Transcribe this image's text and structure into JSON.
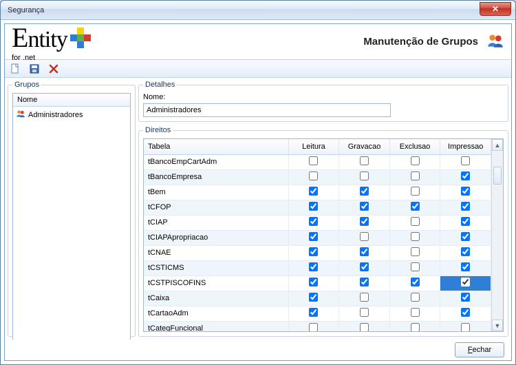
{
  "window": {
    "title": "Segurança"
  },
  "logo": {
    "text": "Entity",
    "tagline": "for .net"
  },
  "header": {
    "title": "Manutenção de Grupos"
  },
  "toolbar": {
    "new_label": "Novo",
    "save_label": "Salvar",
    "delete_label": "Excluir"
  },
  "grupos": {
    "legend": "Grupos",
    "column": "Nome",
    "items": [
      {
        "name": "Administradores",
        "selected": true
      }
    ]
  },
  "detalhes": {
    "legend": "Detalhes",
    "nome_label": "Nome:",
    "nome_value": "Administradores"
  },
  "direitos": {
    "legend": "Direitos",
    "columns": {
      "tabela": "Tabela",
      "leitura": "Leitura",
      "gravacao": "Gravacao",
      "exclusao": "Exclusao",
      "impressao": "Impressao"
    },
    "rows": [
      {
        "tabela": "tBancoEmpCartAdm",
        "leitura": false,
        "gravacao": false,
        "exclusao": false,
        "impressao": false
      },
      {
        "tabela": "tBancoEmpresa",
        "leitura": false,
        "gravacao": false,
        "exclusao": false,
        "impressao": true
      },
      {
        "tabela": "tBem",
        "leitura": true,
        "gravacao": true,
        "exclusao": false,
        "impressao": true
      },
      {
        "tabela": "tCFOP",
        "leitura": true,
        "gravacao": true,
        "exclusao": true,
        "impressao": true
      },
      {
        "tabela": "tCIAP",
        "leitura": true,
        "gravacao": true,
        "exclusao": false,
        "impressao": true
      },
      {
        "tabela": "tCIAPApropriacao",
        "leitura": true,
        "gravacao": false,
        "exclusao": false,
        "impressao": true
      },
      {
        "tabela": "tCNAE",
        "leitura": true,
        "gravacao": true,
        "exclusao": false,
        "impressao": true
      },
      {
        "tabela": "tCSTICMS",
        "leitura": true,
        "gravacao": true,
        "exclusao": false,
        "impressao": true
      },
      {
        "tabela": "tCSTPISCOFINS",
        "leitura": true,
        "gravacao": true,
        "exclusao": true,
        "impressao": true,
        "selected_col": "impressao"
      },
      {
        "tabela": "tCaixa",
        "leitura": true,
        "gravacao": false,
        "exclusao": false,
        "impressao": true
      },
      {
        "tabela": "tCartaoAdm",
        "leitura": true,
        "gravacao": false,
        "exclusao": false,
        "impressao": true
      },
      {
        "tabela": "tCategFuncional",
        "leitura": false,
        "gravacao": false,
        "exclusao": false,
        "impressao": false,
        "cut": true
      }
    ]
  },
  "footer": {
    "close_label": "Fechar"
  }
}
